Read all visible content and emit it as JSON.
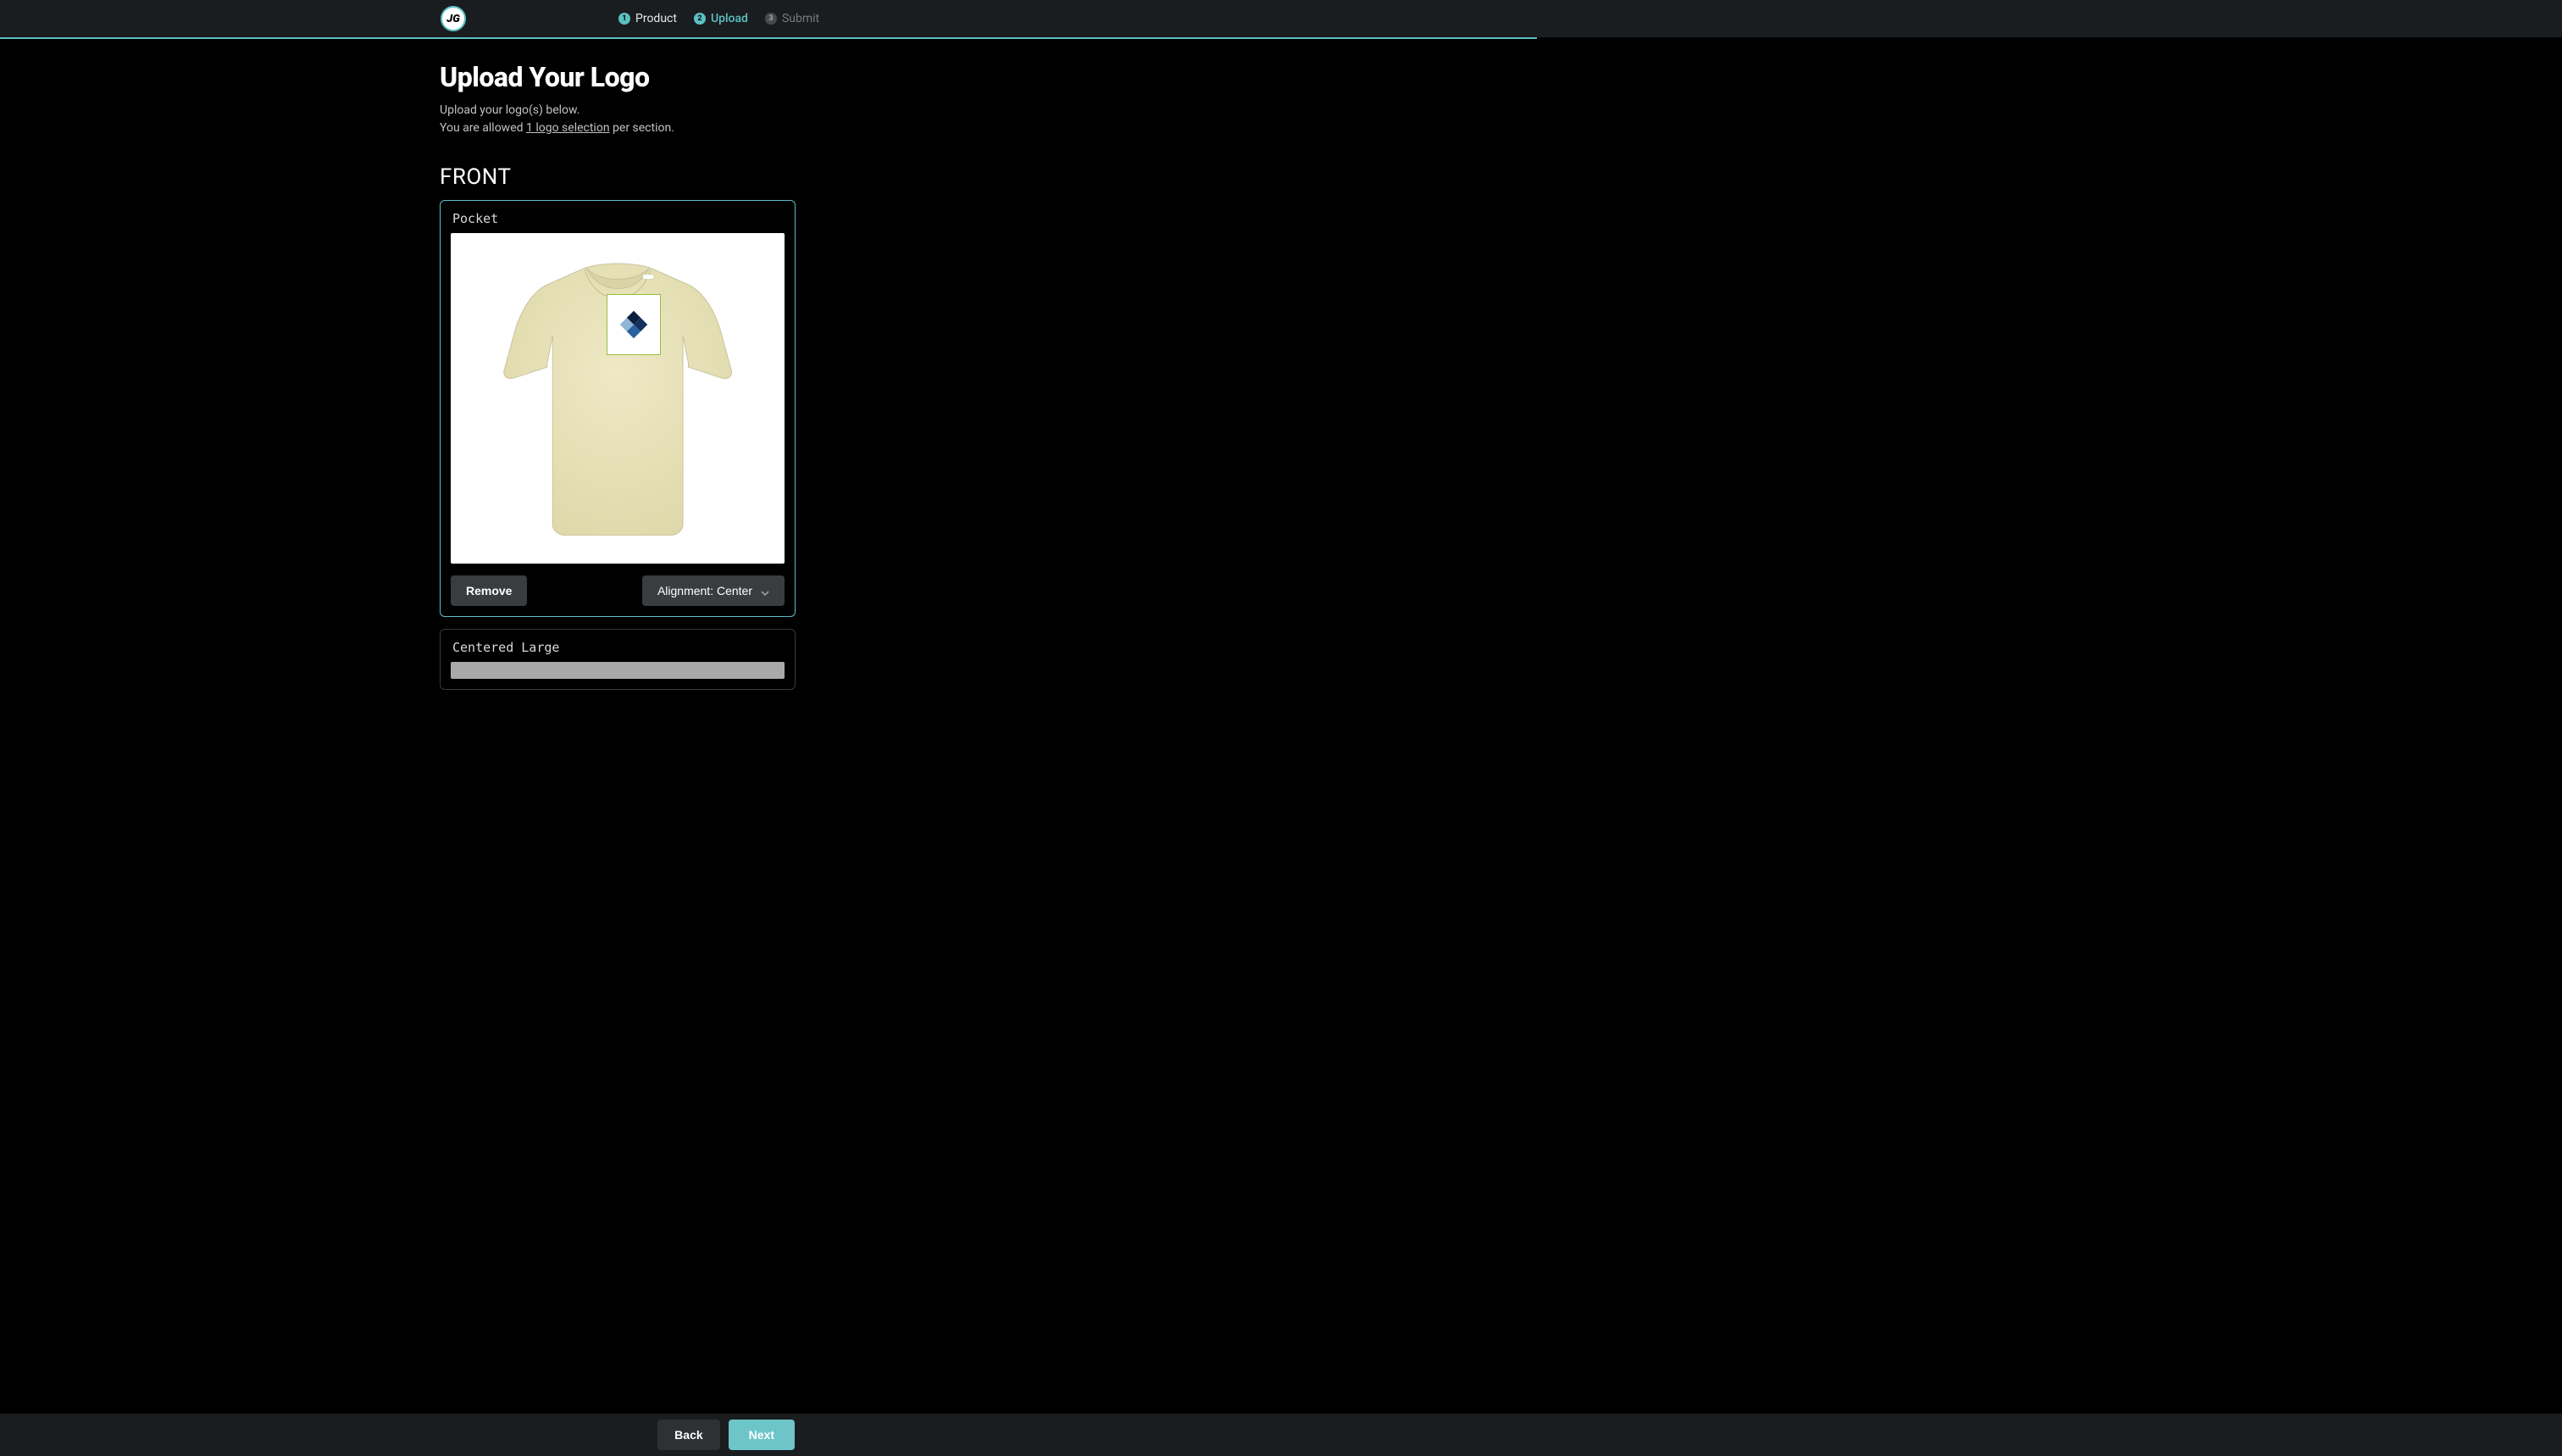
{
  "header": {
    "logo_text": "JG",
    "steps": [
      {
        "num": "1",
        "label": "Product",
        "state": "complete"
      },
      {
        "num": "2",
        "label": "Upload",
        "state": "active"
      },
      {
        "num": "3",
        "label": "Submit",
        "state": "pending"
      }
    ]
  },
  "progress": {
    "percent": 60
  },
  "page": {
    "title": "Upload Your Logo",
    "subtitle_line1": "Upload your logo(s) below.",
    "subtitle_prefix": "You are allowed ",
    "subtitle_emph": "1 logo selection",
    "subtitle_suffix": " per section."
  },
  "section": {
    "title": "FRONT"
  },
  "cards": [
    {
      "label": "Pocket",
      "has_logo": true,
      "remove_label": "Remove",
      "alignment_label": "Alignment: Center"
    },
    {
      "label": "Centered Large",
      "has_logo": false
    }
  ],
  "footer": {
    "back_label": "Back",
    "next_label": "Next"
  },
  "colors": {
    "accent": "#5bc0c4",
    "shirt": "#e7e2b9"
  }
}
